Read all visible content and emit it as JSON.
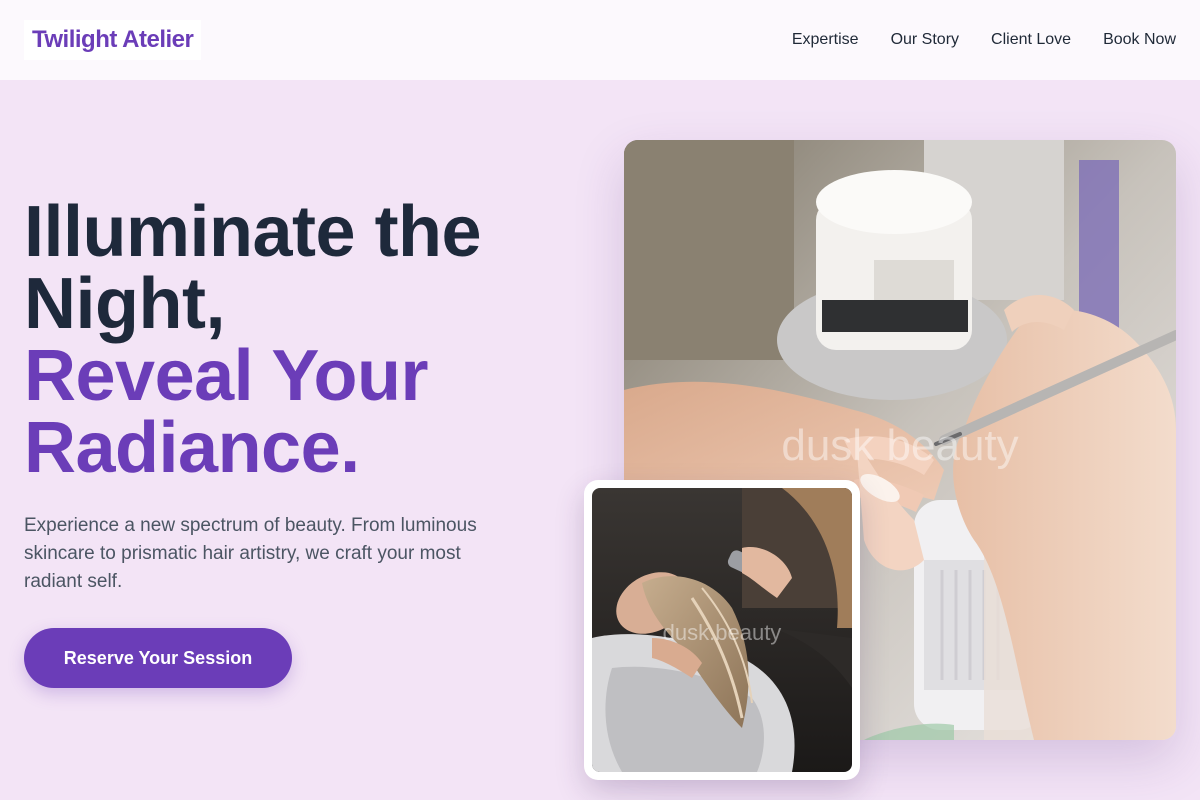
{
  "brand": {
    "name": "Twilight Atelier"
  },
  "nav": {
    "items": [
      "Expertise",
      "Our Story",
      "Client Love",
      "Book Now"
    ]
  },
  "hero": {
    "headline_line1": "Illuminate the",
    "headline_line2": "Night,",
    "headline_accent_line1": "Reveal Your",
    "headline_accent_line2": "Radiance.",
    "subtext": "Experience a new spectrum of beauty. From luminous skincare to prismatic hair artistry, we craft your most radiant self.",
    "cta_label": "Reserve Your Session"
  },
  "images": {
    "main_watermark": "dusk beauty",
    "small_watermark": "dusk.beauty"
  },
  "colors": {
    "background": "#f3e4f6",
    "header": "#fcf9fd",
    "accent": "#6b3db8",
    "headline": "#1e293b"
  }
}
